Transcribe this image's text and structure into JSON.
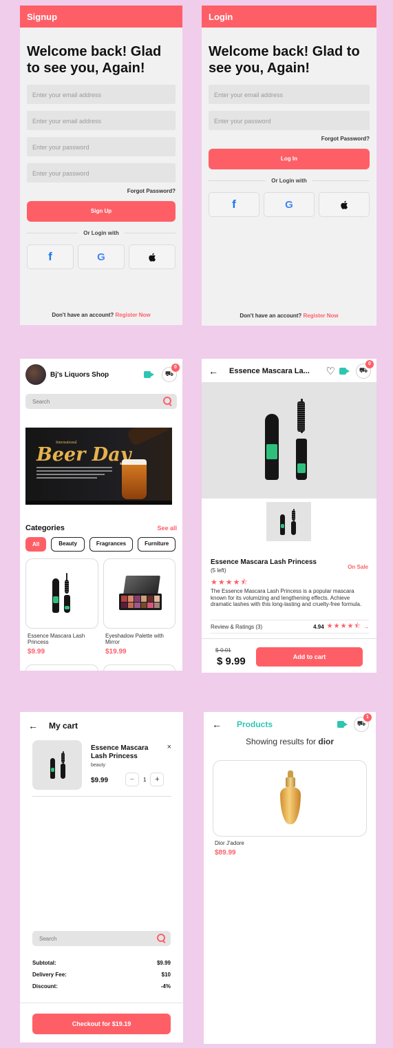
{
  "colors": {
    "background": "#f0cdea",
    "accent": "#fe5f67",
    "teal": "#2ec6b2"
  },
  "signup": {
    "header": "Signup",
    "title": "Welcome back! Glad to see you, Again!",
    "fields": [
      "Enter your email address",
      "Enter your email address",
      "Enter your password",
      "Enter your password"
    ],
    "forgot": "Forgot Password?",
    "button": "Sign Up",
    "or": "Or Login with",
    "footer_text": "Don't have an account?",
    "footer_link": "Register Now"
  },
  "login": {
    "header": "Login",
    "title": "Welcome back! Glad to see you, Again!",
    "fields": [
      "Enter your email address",
      "Enter your password"
    ],
    "forgot": "Forgot Password?",
    "button": "Log In",
    "or": "Or Login with",
    "footer_text": "Don't have an account?",
    "footer_link": "Register Now"
  },
  "social": {
    "facebook": "f",
    "google": "G",
    "apple": ""
  },
  "home": {
    "shop_name": "Bj's Liquors Shop",
    "cart_count": "0",
    "search_placeholder": "Search",
    "banner_small": "International",
    "banner_title": "Beer Day",
    "categories_title": "Categories",
    "see_all": "See all",
    "chips": [
      "All",
      "Beauty",
      "Fragrances",
      "Furniture"
    ],
    "products": [
      {
        "name": "Essence Mascara Lash Princess",
        "price": "$9.99"
      },
      {
        "name": "Eyeshadow Palette with Mirror",
        "price": "$19.99"
      }
    ]
  },
  "detail": {
    "title": "Essence Mascara La...",
    "cart_count": "0",
    "name": "Essence Mascara Lash Princess",
    "stock": "(5 left)",
    "sale": "On Sale",
    "stars": "★★★★⯪",
    "description": "The Essence Mascara Lash Princess is a popular mascara known for its volumizing and lengthening effects. Achieve dramatic lashes with this long-lasting and cruelty-free formula.",
    "reviews_label": "Review & Ratings (3)",
    "rating": "4.94",
    "rating_stars": "★★★★⯪",
    "old_price": "$-0.01",
    "price": "$ 9.99",
    "add_to_cart": "Add to cart"
  },
  "cart": {
    "title": "My cart",
    "item_name": "Essence Mascara Lash Princess",
    "item_category": "beauty",
    "item_price": "$9.99",
    "qty": "1",
    "search_placeholder": "Search",
    "subtotal_label": "Subtotal:",
    "subtotal": "$9.99",
    "delivery_label": "Delivery Fee:",
    "delivery": "$10",
    "discount_label": "Discount:",
    "discount": "-4%",
    "checkout": "Checkout for $19.19"
  },
  "products": {
    "title": "Products",
    "cart_count": "1",
    "showing_prefix": "Showing results for ",
    "query": "dior",
    "item_name": "Dior J'adore",
    "item_price": "$89.99"
  }
}
